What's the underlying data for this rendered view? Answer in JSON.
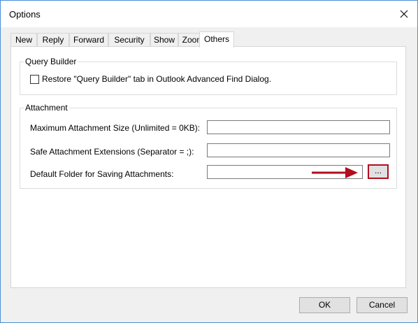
{
  "window": {
    "title": "Options"
  },
  "tabs": [
    {
      "label": "New"
    },
    {
      "label": "Reply"
    },
    {
      "label": "Forward"
    },
    {
      "label": "Security"
    },
    {
      "label": "Show"
    },
    {
      "label": "Zoom"
    },
    {
      "label": "Others",
      "active": true
    }
  ],
  "query_builder": {
    "title": "Query Builder",
    "restore_label": "Restore \"Query Builder\" tab in Outlook Advanced Find Dialog.",
    "restore_checked": false
  },
  "attachment": {
    "title": "Attachment",
    "max_size_label": "Maximum Attachment Size (Unlimited = 0KB):",
    "max_size_value": "",
    "safe_ext_label": "Safe Attachment Extensions (Separator = ;):",
    "safe_ext_value": "",
    "default_folder_label": "Default Folder for Saving Attachments:",
    "default_folder_value": "",
    "browse_label": "..."
  },
  "buttons": {
    "ok": "OK",
    "cancel": "Cancel"
  },
  "colors": {
    "accent_arrow": "#b10e1e",
    "window_border": "#4a90d6"
  }
}
